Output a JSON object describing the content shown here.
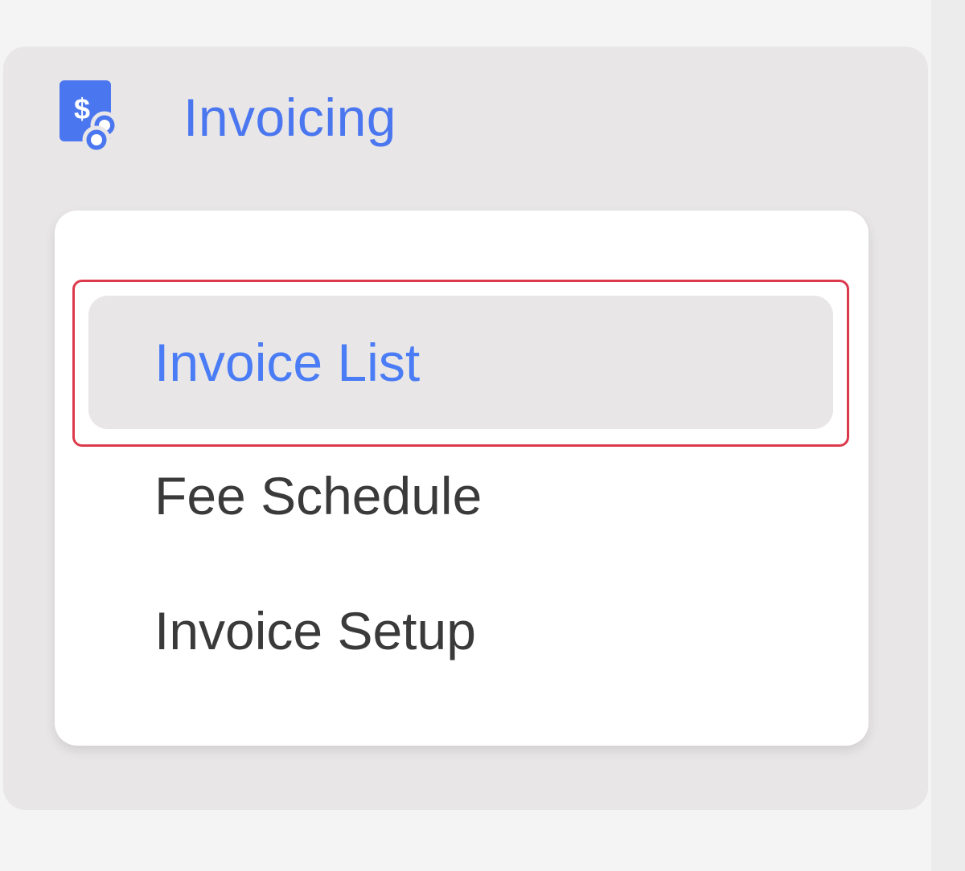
{
  "nav": {
    "title": "Invoicing",
    "icon": "invoice-dollar-coins-icon",
    "accent_color": "#4a76f0"
  },
  "submenu": {
    "items": [
      {
        "label": "Invoice List",
        "active": true
      },
      {
        "label": "Fee Schedule",
        "active": false
      },
      {
        "label": "Invoice Setup",
        "active": false
      }
    ]
  },
  "highlight": {
    "target": "Invoice List",
    "color": "#dc3a4c"
  }
}
